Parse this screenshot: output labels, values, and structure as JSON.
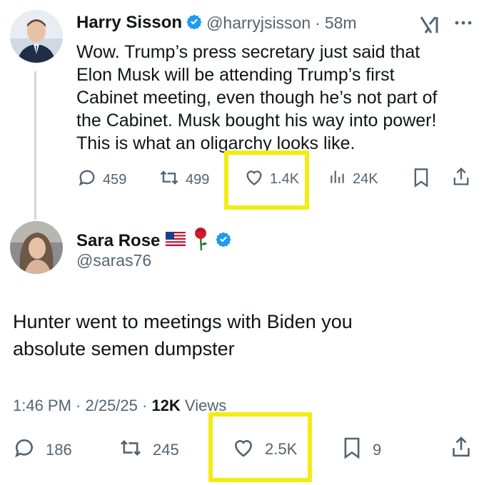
{
  "tweet1": {
    "author_name": "Harry Sisson",
    "handle": "@harryjsisson",
    "time": "58m",
    "text_lines": [
      "Wow. Trump’s press secretary just said that",
      "Elon Musk will be attending Trump’s first",
      "Cabinet meeting, even though he’s not part of",
      "the Cabinet. Musk bought his way into power!",
      "This is what an oligarchy looks like."
    ],
    "replies": "459",
    "reposts": "499",
    "likes": "1.4K",
    "views": "24K"
  },
  "tweet2": {
    "author_name": "Sara Rose",
    "handle": "@saras76",
    "text_lines": [
      "Hunter went to meetings with Biden you",
      "absolute semen dumpster"
    ],
    "timestamp": "1:46 PM · 2/25/25 · ",
    "views_count": "12K",
    "views_label": "Views",
    "replies": "186",
    "reposts": "245",
    "likes": "2.5K",
    "bookmarks": "9"
  },
  "colors": {
    "accent_verified": "#1d9bf0",
    "highlight": "#f2ec14",
    "muted": "#536471"
  },
  "icons": [
    "verified-badge-icon",
    "grok-icon",
    "more-icon",
    "reply-icon",
    "repost-icon",
    "like-icon",
    "views-icon",
    "bookmark-icon",
    "share-icon",
    "us-flag-icon",
    "rose-icon"
  ]
}
